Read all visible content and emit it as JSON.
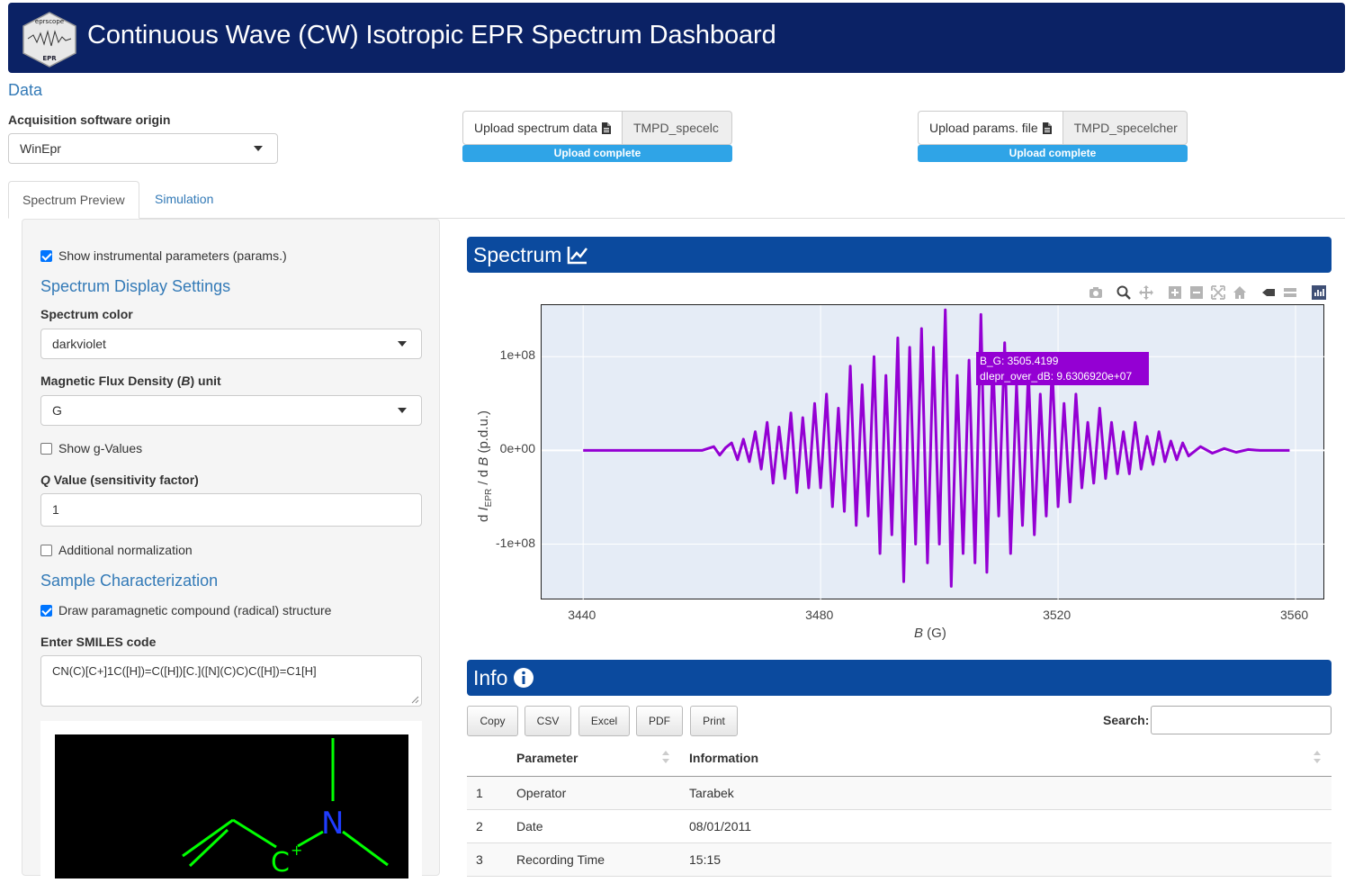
{
  "header": {
    "title": "Continuous Wave (CW) Isotropic EPR Spectrum Dashboard",
    "logo_text": "eprscope",
    "logo_sub": "EPR"
  },
  "data_section": {
    "title": "Data",
    "acquisition_label": "Acquisition software origin",
    "acquisition_value": "WinEpr",
    "upload_spectrum": {
      "button_label": "Upload spectrum data",
      "filename": "TMPD_specelc",
      "progress_label": "Upload complete"
    },
    "upload_params": {
      "button_label": "Upload params. file",
      "filename": "TMPD_specelcher",
      "progress_label": "Upload complete"
    }
  },
  "tabs": [
    {
      "label": "Spectrum Preview",
      "active": true
    },
    {
      "label": "Simulation",
      "active": false
    }
  ],
  "sidebar": {
    "show_params_label": "Show instrumental parameters (params.)",
    "show_params_checked": true,
    "display_settings_title": "Spectrum Display Settings",
    "color_label": "Spectrum color",
    "color_value": "darkviolet",
    "unit_label_prefix": "Magnetic Flux Density (",
    "unit_label_var": "B",
    "unit_label_suffix": ") unit",
    "unit_value": "G",
    "gvalues_label": "Show g-Values",
    "gvalues_checked": false,
    "q_label_var": "Q",
    "q_label_rest": " Value (sensitivity factor)",
    "q_value": "1",
    "norm_label": "Additional normalization",
    "norm_checked": false,
    "sample_title": "Sample Characterization",
    "draw_label": "Draw paramagnetic compound (radical) structure",
    "draw_checked": true,
    "smiles_label": "Enter SMILES code",
    "smiles_value": "CN(C)[C+]1C([H])=C([H])[C.]([N](C)C)C([H])=C1[H]",
    "molecule_atoms": [
      "N",
      "C",
      "+"
    ]
  },
  "spectrum_panel": {
    "title": "Spectrum",
    "icon": "line-chart-icon",
    "modebar_icons": [
      "camera-icon",
      "zoom-icon",
      "pan-icon",
      "zoom-in-icon",
      "zoom-out-icon",
      "autoscale-icon",
      "reset-axes-icon",
      "spike-lines-icon",
      "compare-hover-icon",
      "plotly-logo-icon"
    ]
  },
  "chart_data": {
    "type": "line",
    "xlabel_var": "B",
    "xlabel_unit": " (G)",
    "ylabel": "d I_EPR / d B  (p.d.u.)",
    "xlim": [
      3433,
      3565
    ],
    "ylim": [
      -160000000,
      155000000
    ],
    "x_ticks": [
      "3440",
      "3480",
      "3520",
      "3560"
    ],
    "y_ticks": [
      "1e+08",
      "0e+00",
      "-1e+08"
    ],
    "line_color": "#9400d3",
    "grid": true,
    "hover": {
      "line1": "B_G: 3505.4199",
      "line2": "dIepr_over_dB:  9.6306920e+07"
    },
    "series": [
      {
        "x": [
          3440,
          3460,
          3462,
          3463,
          3464,
          3465,
          3466,
          3467,
          3468,
          3469,
          3470,
          3471,
          3472,
          3473,
          3474,
          3475,
          3476,
          3477,
          3478,
          3479,
          3480,
          3481,
          3482,
          3483,
          3484,
          3485,
          3486,
          3487,
          3488,
          3489,
          3490,
          3491,
          3492,
          3493,
          3494,
          3495,
          3496,
          3497,
          3498,
          3499,
          3500,
          3501,
          3502,
          3503,
          3504,
          3505,
          3506,
          3507,
          3508,
          3509,
          3510,
          3511,
          3512,
          3513,
          3514,
          3515,
          3516,
          3517,
          3518,
          3519,
          3520,
          3521,
          3522,
          3523,
          3524,
          3525,
          3526,
          3527,
          3528,
          3529,
          3530,
          3531,
          3532,
          3533,
          3534,
          3535,
          3536,
          3537,
          3538,
          3539,
          3540,
          3541,
          3542,
          3544,
          3546,
          3548,
          3550,
          3552,
          3554,
          3559
        ],
        "y": [
          0,
          0,
          4000000,
          -5000000,
          3000000,
          8000000,
          -10000000,
          12000000,
          -12000000,
          20000000,
          -20000000,
          30000000,
          -35000000,
          25000000,
          -30000000,
          40000000,
          -45000000,
          35000000,
          -40000000,
          50000000,
          -40000000,
          60000000,
          -60000000,
          45000000,
          -65000000,
          90000000,
          -80000000,
          70000000,
          -70000000,
          100000000,
          -110000000,
          80000000,
          -90000000,
          120000000,
          -140000000,
          110000000,
          -100000000,
          130000000,
          -120000000,
          110000000,
          -100000000,
          150000000,
          -145000000,
          80000000,
          -110000000,
          96306920,
          -120000000,
          145000000,
          -130000000,
          100000000,
          -70000000,
          115000000,
          -110000000,
          70000000,
          -80000000,
          85000000,
          -90000000,
          60000000,
          -70000000,
          90000000,
          -60000000,
          50000000,
          -55000000,
          60000000,
          -40000000,
          30000000,
          -35000000,
          45000000,
          -30000000,
          30000000,
          -25000000,
          20000000,
          -25000000,
          30000000,
          -20000000,
          15000000,
          -15000000,
          20000000,
          -12000000,
          10000000,
          -10000000,
          8000000,
          -6000000,
          4000000,
          -3000000,
          2000000,
          -2000000,
          1000000,
          0,
          0
        ]
      }
    ]
  },
  "info_panel": {
    "title": "Info",
    "icon": "info-circle-icon",
    "buttons": [
      "Copy",
      "CSV",
      "Excel",
      "PDF",
      "Print"
    ],
    "search_label": "Search:",
    "search_value": "",
    "columns": [
      "",
      "Parameter",
      "Information"
    ],
    "rows": [
      [
        "1",
        "Operator",
        "Tarabek"
      ],
      [
        "2",
        "Date",
        "08/01/2011"
      ],
      [
        "3",
        "Recording Time",
        "15:15"
      ]
    ]
  }
}
